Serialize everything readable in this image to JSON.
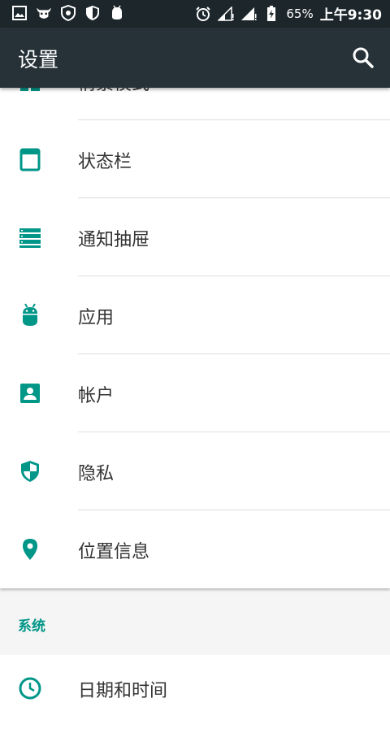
{
  "status_bar": {
    "battery": "65%",
    "time": "上午9:30",
    "icons": [
      "image-icon",
      "bull-icon",
      "shield-badge-icon",
      "shield-icon",
      "android-icon",
      "alarm-icon",
      "signal-icon",
      "signal-icon",
      "battery-charging-icon"
    ]
  },
  "app_bar": {
    "title": "设置",
    "search_icon": "search-icon"
  },
  "settings_items": [
    {
      "label": "情景模式",
      "icon": "scene-mode-icon"
    },
    {
      "label": "状态栏",
      "icon": "status-bar-icon"
    },
    {
      "label": "通知抽屉",
      "icon": "notification-drawer-icon"
    },
    {
      "label": "应用",
      "icon": "android-icon"
    },
    {
      "label": "帐户",
      "icon": "account-icon"
    },
    {
      "label": "隐私",
      "icon": "privacy-shield-icon"
    },
    {
      "label": "位置信息",
      "icon": "location-pin-icon"
    }
  ],
  "system_section": {
    "header": "系统",
    "first_item": {
      "label": "日期和时间",
      "icon": "clock-icon"
    }
  },
  "colors": {
    "status_bar": "#1c262b",
    "app_bar": "#263238",
    "accent": "#009688",
    "background": "#f5f5f5"
  }
}
